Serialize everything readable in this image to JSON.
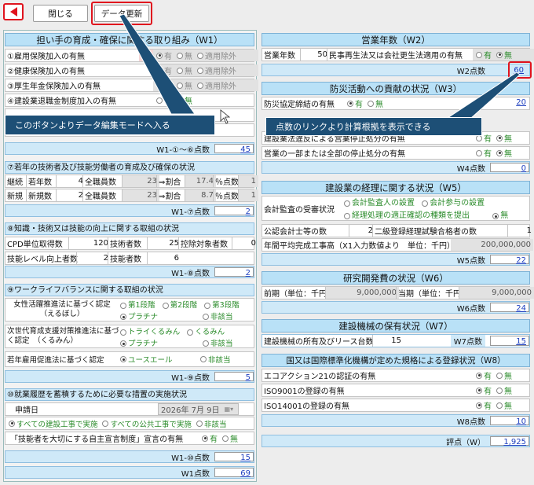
{
  "toolbar": {
    "close": "閉じる",
    "update": "データ更新"
  },
  "callouts": {
    "left": "このボタンよりデータ編集モードへ入る",
    "right": "点数のリンクより計算根拠を表示できる"
  },
  "radio": {
    "yes": "有",
    "no": "無",
    "exempt": "適用除外",
    "na": "非該当"
  },
  "w1": {
    "title": "担い手の育成・確保に関する取り組み（W1）",
    "items": [
      "①雇用保険加入の有無",
      "②健康保険加入の有無",
      "③厚生年金保険加入の有無",
      "④建設業退職金制度加入の有無"
    ],
    "badge": "1",
    "score16_label": "W1-①～⑥点数",
    "score16": "45",
    "s7_title": "⑦若年の技術者及び技能労働者の育成及び確保の状況",
    "s7_rows": [
      {
        "a": "継続",
        "b": "若年数",
        "c": "4",
        "d": "全職員数",
        "e": "23",
        "f": "⇒割合",
        "g": "17.4",
        "h": "％点数",
        "i": "1"
      },
      {
        "a": "新規",
        "b": "新規数",
        "c": "2",
        "d": "全職員数",
        "e": "23",
        "f": "⇒割合",
        "g": "8.7",
        "h": "％点数",
        "i": "1"
      }
    ],
    "score7_label": "W1-⑦点数",
    "score7": "2",
    "s8_title": "⑧知識・技術又は技能の向上に関する取組の状況",
    "s8_r1": {
      "a": "CPD単位取得数",
      "b": "120",
      "c": "技術者数",
      "d": "25",
      "e": "控除対象者数",
      "f": "0"
    },
    "s8_r2": {
      "a": "技能レベル向上者数",
      "b": "2",
      "c": "技能者数",
      "d": "6"
    },
    "score8_label": "W1-⑧点数",
    "score8": "2",
    "s9_title": "⑨ワークライフバランスに関する取組の状況",
    "s9_r1": {
      "label": "女性活躍推進法に基づく認定\n（えるぼし）",
      "o1": "第1段階",
      "o2": "第2段階",
      "o3": "第3段階",
      "o4": "プラチナ",
      "o5": "非該当"
    },
    "s9_r2": {
      "label": "次世代育成支援対策推進法に基づく認定　（くるみん）",
      "o1": "トライくるみん",
      "o2": "くるみん",
      "o3": "プラチナ",
      "o4": "非該当"
    },
    "s9_r3": {
      "label": "若年雇用促進法に基づく認定",
      "o1": "ユースエール",
      "o2": "非該当"
    },
    "score9_label": "W1-⑨点数",
    "score9": "5",
    "s10_title": "⑩就業履歴を蓄積するために必要な措置の実施状況",
    "s10_date_label": "申請日",
    "s10_date": "2026年 7月 9日",
    "s10_o1": "すべての建設工事で実施",
    "s10_o2": "すべての公共工事で実施",
    "s10_o3": "非該当",
    "s10_r2_label": "「技能者を大切にする自主宣言制度」宣言の有無",
    "score10_label": "W1-⑩点数",
    "score10": "15",
    "total_label": "W1点数",
    "total": "69"
  },
  "w2": {
    "title": "営業年数（W2）",
    "years_label": "営業年数",
    "years": "50",
    "rehab_label": "民事再生法又は会社更生法適用の有無",
    "score_label": "W2点数",
    "score": "60"
  },
  "w3": {
    "title": "防災活動への貢献の状況（W3）",
    "label": "防災協定締結の有無",
    "score": "20"
  },
  "w4": {
    "label1": "建設業法違反による営業停止処分の有無",
    "label2": "営業の一部または全部の停止処分の有無",
    "score_label": "W4点数",
    "score": "0"
  },
  "w5": {
    "title": "建設業の経理に関する状況（W5）",
    "audit_label": "会計監査の受審状況",
    "o1": "会計監査人の設置",
    "o2": "会計参与の設置",
    "o3": "経理処理の適正確認の種類を提出",
    "o4": "無",
    "cpa_label": "公認会計士等の数",
    "cpa": "2",
    "second_label": "二級登録経理試験合格者の数",
    "second": "1",
    "avg_label": "年間平均完成工事高（X1入力数値より　単位：千円）",
    "avg": "200,000,000",
    "score_label": "W5点数",
    "score": "22"
  },
  "w6": {
    "title": "研究開発費の状況（W6）",
    "prev_label": "前期（単位：千円）",
    "prev": "9,000,000",
    "cur_label": "当期（単位：千円）",
    "cur": "9,000,000",
    "score_label": "W6点数",
    "score": "24"
  },
  "w7": {
    "title": "建設機械の保有状況（W7）",
    "label": "建設機械の所有及びリース台数",
    "count": "15",
    "score_label": "W7点数",
    "score": "15"
  },
  "w8": {
    "title": "国又は国際標準化機構が定めた規格による登録状況（W8）",
    "items": [
      "エコアクション21の認証の有無",
      "ISO9001の登録の有無",
      "ISO14001の登録の有無"
    ],
    "score_label": "W8点数",
    "score": "10"
  },
  "wtotal": {
    "label": "評点（W）",
    "value": "1,925"
  }
}
